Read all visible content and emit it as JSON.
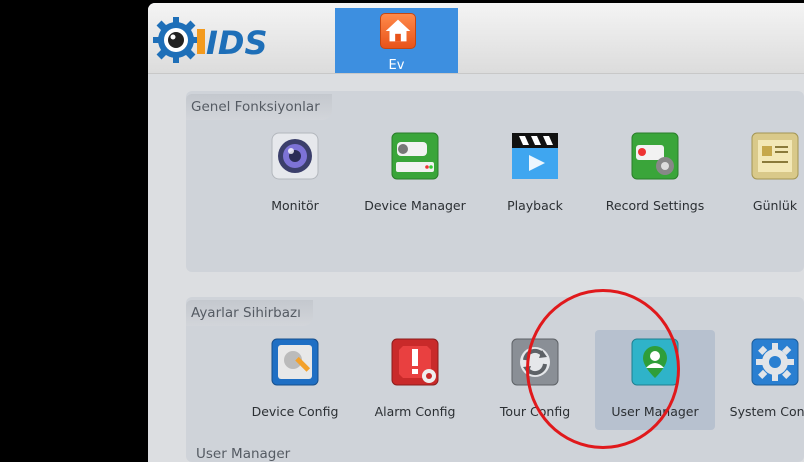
{
  "app": {
    "logo_text": "IDS"
  },
  "header": {
    "home_tab": {
      "label": "Ev",
      "icon": "home-icon"
    }
  },
  "general": {
    "title": "Genel Fonksiyonlar",
    "items": [
      {
        "label": "Monitör",
        "icon": "monitor-lens-icon"
      },
      {
        "label": "Device Manager",
        "icon": "device-manager-icon"
      },
      {
        "label": "Playback",
        "icon": "playback-clapper-icon"
      },
      {
        "label": "Record Settings",
        "icon": "record-settings-icon"
      },
      {
        "label": "Günlük",
        "icon": "log-book-icon"
      }
    ]
  },
  "settings": {
    "title": "Ayarlar Sihirbazı",
    "items": [
      {
        "label": "Device Config",
        "icon": "device-config-icon"
      },
      {
        "label": "Alarm Config",
        "icon": "alarm-config-icon"
      },
      {
        "label": "Tour Config",
        "icon": "tour-config-icon"
      },
      {
        "label": "User Manager",
        "icon": "user-manager-icon",
        "selected": true
      },
      {
        "label": "System Config",
        "icon": "system-config-gear-icon"
      }
    ]
  },
  "status": {
    "text": "User Manager"
  },
  "colors": {
    "accent": "#3d8fe0",
    "highlight": "#e0191c"
  }
}
